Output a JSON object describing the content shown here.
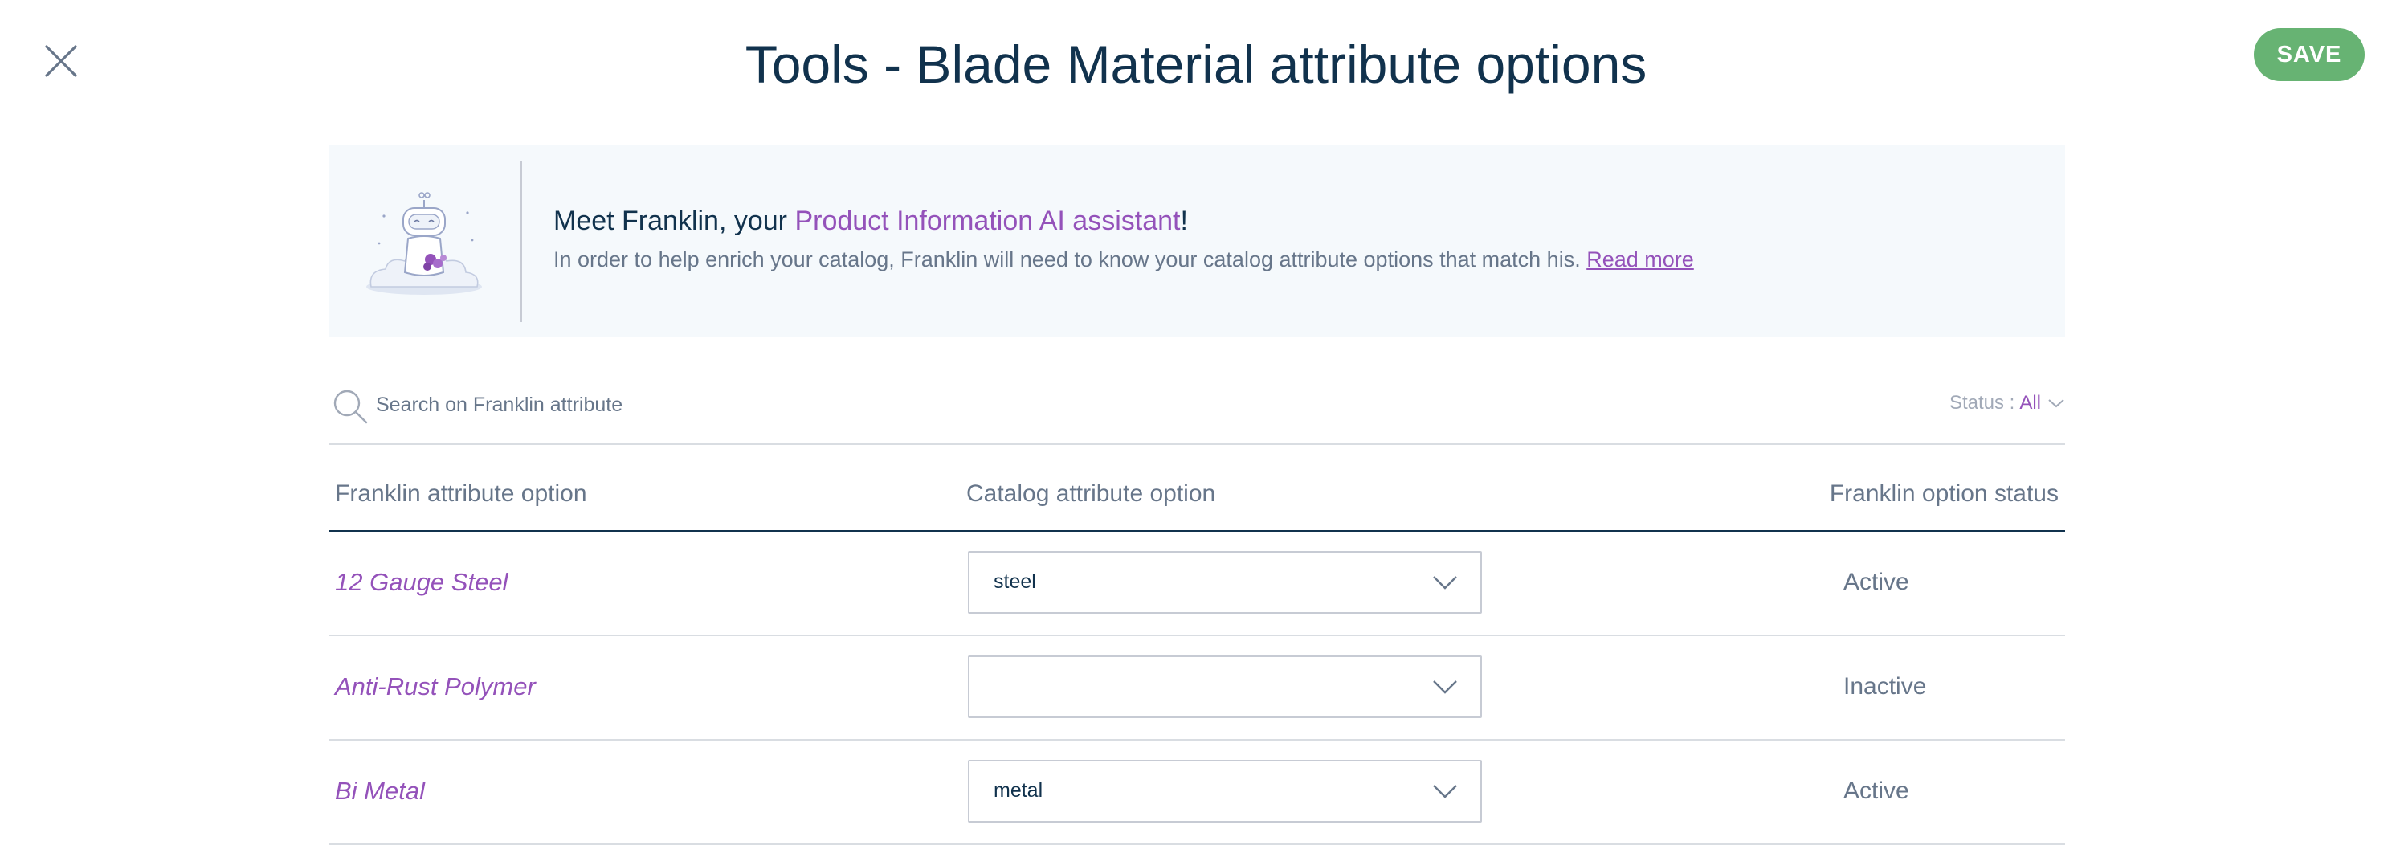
{
  "header": {
    "title": "Tools - Blade Material attribute options",
    "save_label": "SAVE",
    "colors": {
      "title": "#11324d",
      "save_bg": "#67b373",
      "accent": "#9452ba"
    }
  },
  "banner": {
    "title_prefix": "Meet Franklin, your ",
    "title_link": "Product Information AI assistant",
    "title_suffix": "!",
    "description": "In order to help enrich your catalog, Franklin will need to know your catalog attribute options that match his. ",
    "read_more": "Read more",
    "illustration_icon": "franklin-robot-illustration"
  },
  "search": {
    "placeholder": "Search on Franklin attribute",
    "value": "",
    "icon": "search-icon"
  },
  "filter": {
    "label": "Status :",
    "value": "All"
  },
  "table": {
    "columns": [
      "Franklin attribute option",
      "Catalog attribute option",
      "Franklin option status"
    ],
    "rows": [
      {
        "franklin_option": "12 Gauge Steel",
        "catalog_option": "steel",
        "status": "Active"
      },
      {
        "franklin_option": "Anti-Rust Polymer",
        "catalog_option": "",
        "status": "Inactive"
      },
      {
        "franklin_option": "Bi Metal",
        "catalog_option": "metal",
        "status": "Active"
      }
    ]
  }
}
